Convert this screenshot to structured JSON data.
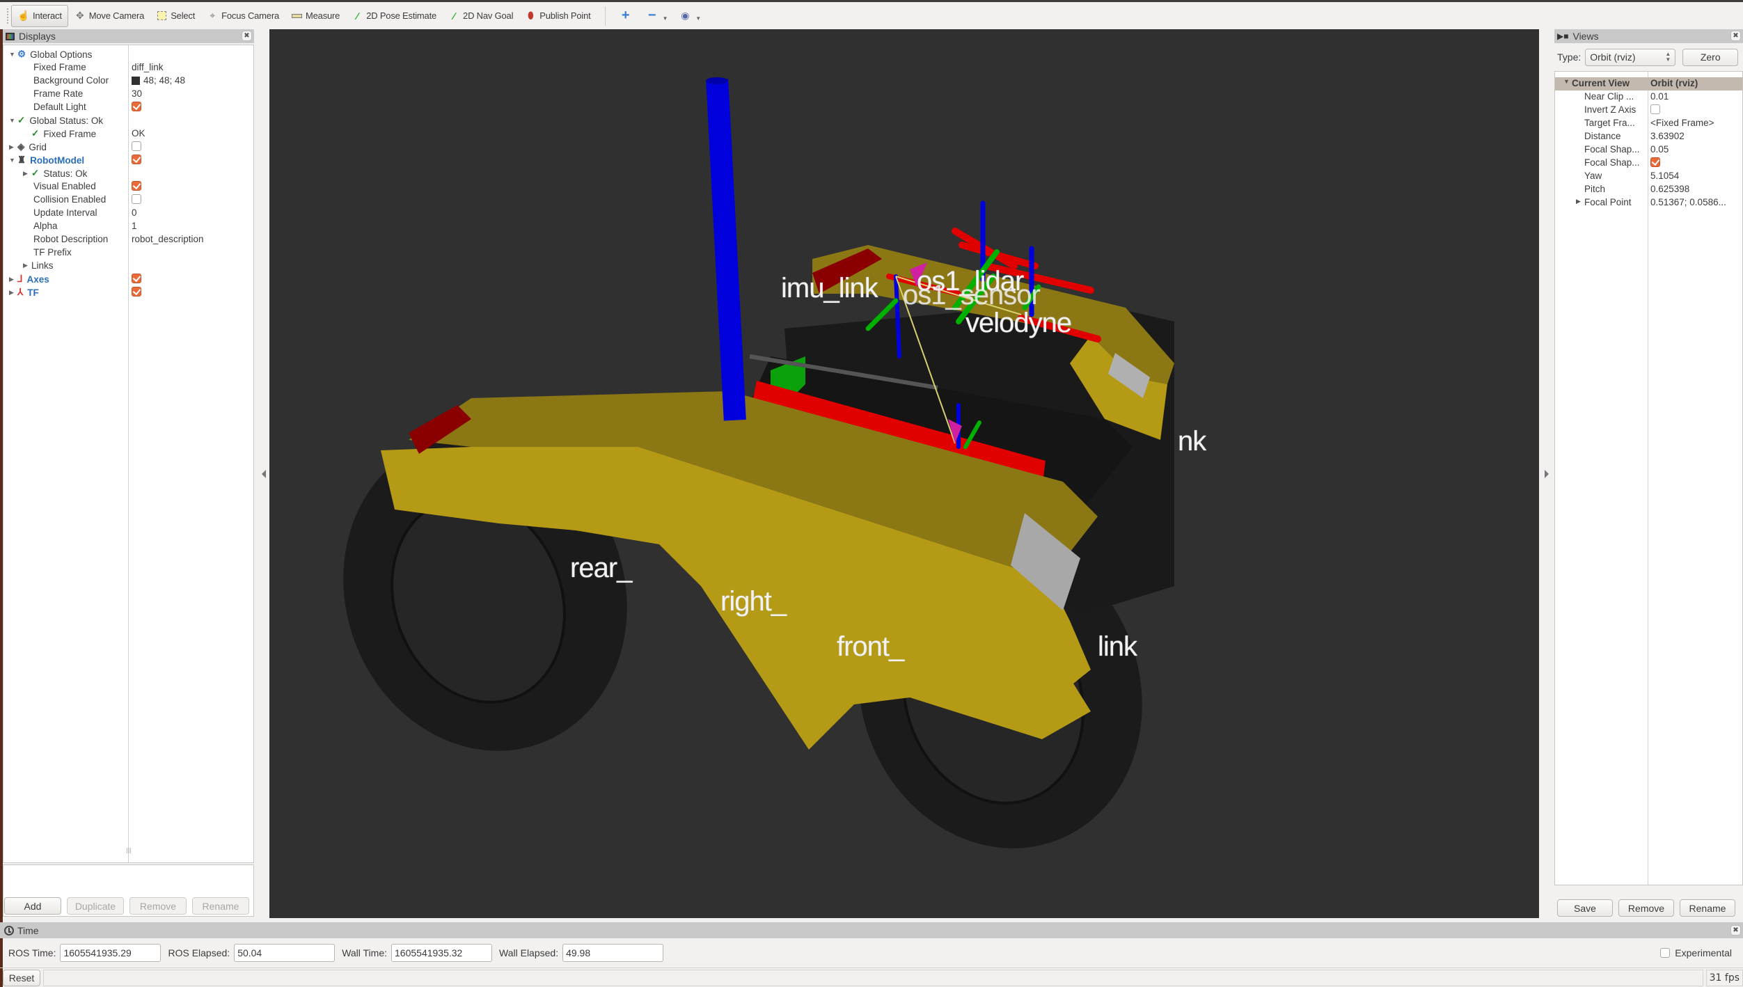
{
  "toolbar": {
    "tools": [
      {
        "label": "Interact",
        "icon": "hand-pointer-icon",
        "active": true
      },
      {
        "label": "Move Camera",
        "icon": "move-camera-icon",
        "active": false
      },
      {
        "label": "Select",
        "icon": "select-box-icon",
        "active": false
      },
      {
        "label": "Focus Camera",
        "icon": "focus-crosshair-icon",
        "active": false
      },
      {
        "label": "Measure",
        "icon": "ruler-icon",
        "active": false
      },
      {
        "label": "2D Pose Estimate",
        "icon": "green-arrow-icon",
        "active": false
      },
      {
        "label": "2D Nav Goal",
        "icon": "green-arrow-icon",
        "active": false
      },
      {
        "label": "Publish Point",
        "icon": "map-pin-icon",
        "active": false
      }
    ],
    "extra": [
      "add-tool-icon",
      "remove-tool-icon",
      "camera-type-eye-icon"
    ]
  },
  "displays": {
    "title": "Displays",
    "rows": [
      {
        "indent": 0,
        "tri": "open",
        "icon": "gear",
        "label": "Global Options",
        "value": "",
        "bold": false
      },
      {
        "indent": 1,
        "label": "Fixed Frame",
        "value": "diff_link"
      },
      {
        "indent": 1,
        "label": "Background Color",
        "value": "48; 48; 48",
        "swatch": "#303030"
      },
      {
        "indent": 1,
        "label": "Frame Rate",
        "value": "30"
      },
      {
        "indent": 1,
        "label": "Default Light",
        "check": true
      },
      {
        "indent": 0,
        "tri": "open",
        "icon": "ok",
        "label": "Global Status: Ok",
        "value": ""
      },
      {
        "indent": 1,
        "icon": "ok",
        "label": "Fixed Frame",
        "value": "OK"
      },
      {
        "indent": 0,
        "tri": "closed",
        "icon": "grid",
        "label": "Grid",
        "check": false
      },
      {
        "indent": 0,
        "tri": "open",
        "icon": "robot",
        "label": "RobotModel",
        "check": true,
        "blue": true
      },
      {
        "indent": 1,
        "tri": "closed",
        "icon": "ok",
        "label": "Status: Ok",
        "value": ""
      },
      {
        "indent": 1,
        "label": "Visual Enabled",
        "check": true
      },
      {
        "indent": 1,
        "label": "Collision Enabled",
        "check": false
      },
      {
        "indent": 1,
        "label": "Update Interval",
        "value": "0"
      },
      {
        "indent": 1,
        "label": "Alpha",
        "value": "1"
      },
      {
        "indent": 1,
        "label": "Robot Description",
        "value": "robot_description"
      },
      {
        "indent": 1,
        "label": "TF Prefix",
        "value": ""
      },
      {
        "indent": 1,
        "tri": "closed",
        "label": "Links",
        "value": ""
      },
      {
        "indent": 0,
        "tri": "closed",
        "icon": "axes",
        "label": "Axes",
        "check": true,
        "blue": true
      },
      {
        "indent": 0,
        "tri": "closed",
        "icon": "tf",
        "label": "TF",
        "check": true,
        "blue": true
      }
    ],
    "buttons": {
      "add": "Add",
      "duplicate": "Duplicate",
      "remove": "Remove",
      "rename": "Rename"
    }
  },
  "viewport": {
    "background": "#303030",
    "frame_labels": [
      "imu_link",
      "os1_lidar",
      "os1_sensor",
      "velodyne",
      "rear_",
      "right_",
      "front_",
      "link",
      "nk"
    ]
  },
  "views": {
    "title": "Views",
    "type_label": "Type:",
    "type_value": "Orbit (rviz)",
    "zero": "Zero",
    "header": {
      "label": "Current View",
      "value": "Orbit (rviz)"
    },
    "rows": [
      {
        "label": "Near Clip ...",
        "value": "0.01"
      },
      {
        "label": "Invert Z Axis",
        "check": false
      },
      {
        "label": "Target Fra...",
        "value": "<Fixed Frame>"
      },
      {
        "label": "Distance",
        "value": "3.63902"
      },
      {
        "label": "Focal Shap...",
        "value": "0.05"
      },
      {
        "label": "Focal Shap...",
        "check": true
      },
      {
        "label": "Yaw",
        "value": "5.1054"
      },
      {
        "label": "Pitch",
        "value": "0.625398"
      },
      {
        "label": "Focal Point",
        "value": "0.51367; 0.0586...",
        "tri": "closed"
      }
    ],
    "buttons": {
      "save": "Save",
      "remove": "Remove",
      "rename": "Rename"
    }
  },
  "time": {
    "title": "Time",
    "ros_time_label": "ROS Time:",
    "ros_time": "1605541935.29",
    "ros_elapsed_label": "ROS Elapsed:",
    "ros_elapsed": "50.04",
    "wall_time_label": "Wall Time:",
    "wall_time": "1605541935.32",
    "wall_elapsed_label": "Wall Elapsed:",
    "wall_elapsed": "49.98",
    "experimental": "Experimental",
    "experimental_checked": false
  },
  "status": {
    "reset": "Reset",
    "fps": "31 fps"
  }
}
